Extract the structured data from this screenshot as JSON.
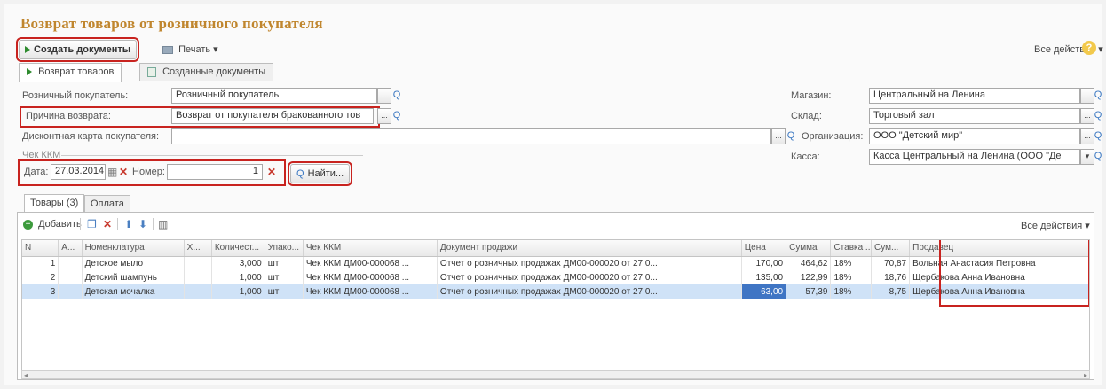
{
  "window": {
    "title": "Возврат товаров от розничного покупателя"
  },
  "toolbar": {
    "create_label": "Создать документы",
    "print_label": "Печать ▾",
    "all_actions_label": "Все действия ▾"
  },
  "tabs": [
    {
      "label": "Возврат товаров"
    },
    {
      "label": "Созданные документы"
    }
  ],
  "form": {
    "customer_label": "Розничный покупатель:",
    "customer_value": "Розничный покупатель",
    "reason_label": "Причина возврата:",
    "reason_value": "Возврат от покупателя бракованного тов",
    "discount_label": "Дисконтная карта покупателя:",
    "discount_value": "",
    "store_label": "Магазин:",
    "store_value": "Центральный на Ленина",
    "warehouse_label": "Склад:",
    "warehouse_value": "Торговый зал",
    "org_label": "Организация:",
    "org_value": "ООО \"Детский мир\"",
    "cashbox_label": "Касса:",
    "cashbox_value": "Касса Центральный на Ленина (ООО \"Де",
    "receipt_section_label": "Чек ККМ",
    "date_label": "Дата:",
    "date_value": "27.03.2014",
    "number_label": "Номер:",
    "number_value": "1",
    "find_label": "Найти..."
  },
  "inner_tabs": [
    {
      "label": "Товары (3)"
    },
    {
      "label": "Оплата"
    }
  ],
  "table_toolbar": {
    "add_label": "Добавить",
    "all_actions_label": "Все действия ▾"
  },
  "table": {
    "columns": [
      "N",
      "А...",
      "Номенклатура",
      "Х...",
      "Количест...",
      "Упако...",
      "Чек ККМ",
      "Документ продажи",
      "Цена",
      "Сумма",
      "Ставка ...",
      "Сум...",
      "Продавец"
    ],
    "rows": [
      [
        "1",
        "",
        "Детское мыло",
        "",
        "3,000",
        "шт",
        "Чек ККМ ДМ00-000068 ...",
        "Отчет о розничных продажах ДМ00-000020 от 27.0...",
        "170,00",
        "464,62",
        "18%",
        "70,87",
        "Вольная Анастасия Петровна"
      ],
      [
        "2",
        "",
        "Детский шампунь",
        "",
        "1,000",
        "шт",
        "Чек ККМ ДМ00-000068 ...",
        "Отчет о розничных продажах ДМ00-000020 от 27.0...",
        "135,00",
        "122,99",
        "18%",
        "18,76",
        "Щербакова Анна Ивановна"
      ],
      [
        "3",
        "",
        "Детская мочалка",
        "",
        "1,000",
        "шт",
        "Чек ККМ ДМ00-000068 ...",
        "Отчет о розничных продажах ДМ00-000020 от 27.0...",
        "63,00",
        "57,39",
        "18%",
        "8,75",
        "Щербакова Анна Ивановна"
      ]
    ]
  }
}
